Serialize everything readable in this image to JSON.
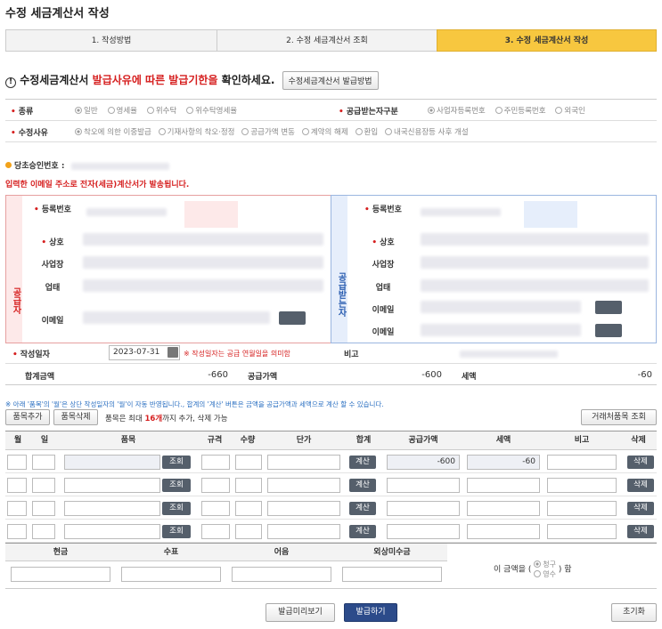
{
  "page": {
    "title": "수정 세금계산서 작성"
  },
  "steps": [
    "1. 작성방법",
    "2. 수정 세금계산서 조회",
    "3. 수정 세금계산서 작성"
  ],
  "notice": {
    "prefix": "수정세금계산서 ",
    "red": "발급사유에 따른 발급기한을",
    "suffix": " 확인하세요.",
    "button": "수정세금계산서 발급방법"
  },
  "form": {
    "type_label": "종류",
    "type_options": [
      "일반",
      "영세율",
      "위수탁",
      "위수탁영세율"
    ],
    "receiver_label": "공급받는자구분",
    "receiver_options": [
      "사업자등록번호",
      "주민등록번호",
      "외국인"
    ],
    "reason_label": "수정사유",
    "reason_options": [
      "착오에 의한 이중발급",
      "기재사항의 착오·정정",
      "공급가액 변동",
      "계약의 해제",
      "환입",
      "내국신용장등 사후 개설"
    ]
  },
  "approval_label": "당초승인번호 :",
  "email_notice": "입력한 이메일 주소로 전자(세금)계산서가 발송됩니다.",
  "supplier": {
    "side": "공급자",
    "reg": "등록번호",
    "name": "상호",
    "addr": "사업장",
    "biz": "업태",
    "email": "이메일"
  },
  "buyer": {
    "side": "공급받는자",
    "reg": "등록번호",
    "name": "상호",
    "addr": "사업장",
    "biz": "업태",
    "email": "이메일",
    "email2": "이메일"
  },
  "write_date": {
    "label": "작성일자",
    "value": "2023-07-31",
    "note": "※ 작성일자는 공급 연월일을 의미함",
    "remark": "비고"
  },
  "totals": {
    "total_label": "합계금액",
    "total": "-660",
    "supply_label": "공급가액",
    "supply": "-600",
    "tax_label": "세액",
    "tax": "-60"
  },
  "hint": "※ 아래 '품목'의 '월'은 상단 작성일자의 '월'이 자동 반영됩니다., 합계의 '계산' 버튼은 금액을 공급가액과 세액으로 계산 할 수 있습니다.",
  "item_buttons": {
    "add": "품목추가",
    "del": "품목삭제",
    "info_prefix": "품목은 최대 ",
    "info_red": "16개",
    "info_suffix": "까지 추가, 삭제 가능",
    "lookup": "거래처품목 조회"
  },
  "table": {
    "headers": [
      "월",
      "일",
      "품목",
      "규격",
      "수량",
      "단가",
      "합계",
      "공급가액",
      "세액",
      "비고",
      "삭제"
    ],
    "lookup": "조회",
    "calc": "계산",
    "delete": "삭제",
    "row1": {
      "supply": "-600",
      "tax": "-60"
    }
  },
  "payment": {
    "headers": [
      "현금",
      "수표",
      "어음",
      "외상미수금"
    ],
    "amount_prefix": "이 금액을 (",
    "charge": "청구",
    "receipt": "영수",
    "amount_suffix": ") 함"
  },
  "bottom": {
    "preview": "발급미리보기",
    "issue": "발급하기",
    "reset": "초기화"
  },
  "colors": {
    "accent": "#f7c73f",
    "red": "#d62020",
    "navy": "#2c4b8a",
    "supplier_border": "#e6a0a0",
    "buyer_border": "#9bb6e0"
  }
}
